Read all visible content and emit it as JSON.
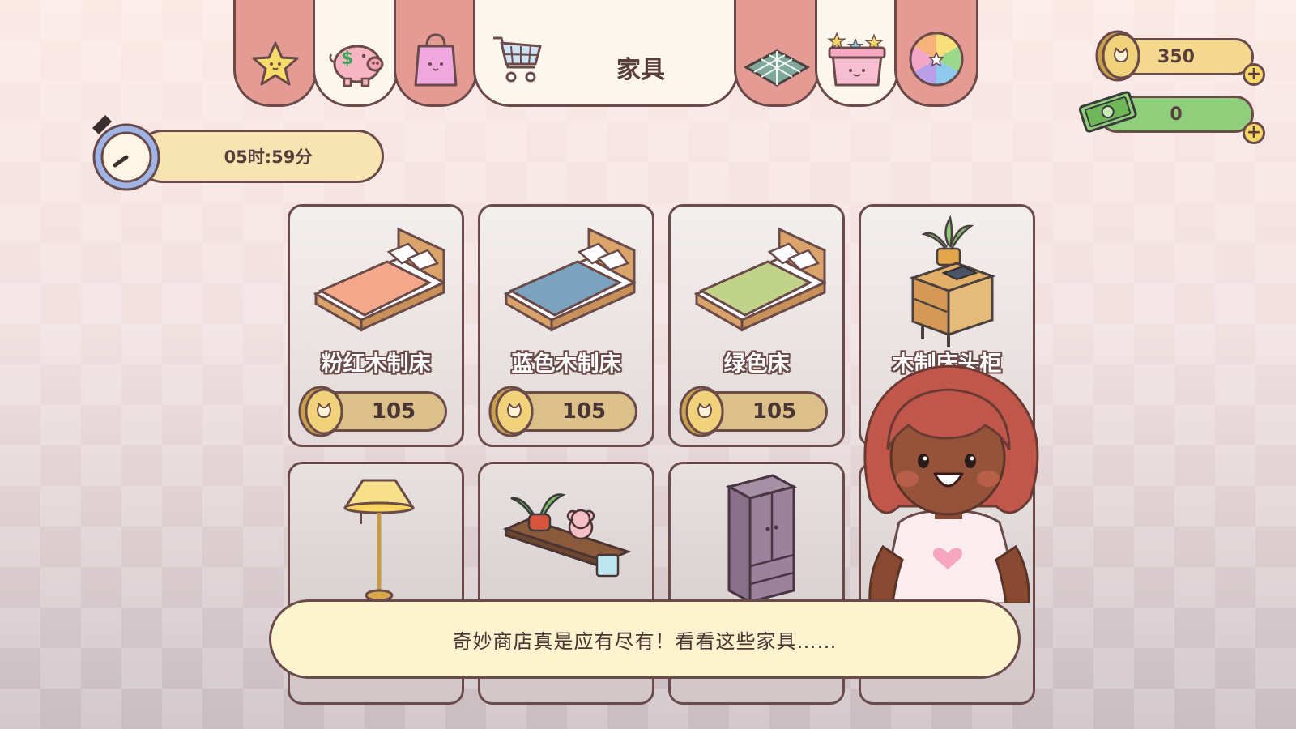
{
  "shop": {
    "tabs": [
      {
        "icon": "star-icon"
      },
      {
        "icon": "piggy-bank-icon"
      },
      {
        "icon": "shopping-bag-icon"
      },
      {
        "icon": "shopping-cart-icon",
        "label": "家具",
        "active": true
      },
      {
        "icon": "floor-tile-icon"
      },
      {
        "icon": "gift-box-icon"
      },
      {
        "icon": "prize-wheel-icon"
      }
    ]
  },
  "currency": {
    "coins": "350",
    "cash": "0"
  },
  "timer": {
    "text": "05时:59分"
  },
  "items": [
    {
      "name": "粉红木制床",
      "price": "105",
      "icon": "pink-bed-icon"
    },
    {
      "name": "蓝色木制床",
      "price": "105",
      "icon": "blue-bed-icon"
    },
    {
      "name": "绿色床",
      "price": "105",
      "icon": "green-bed-icon"
    },
    {
      "name": "木制床头柜",
      "icon": "nightstand-icon"
    },
    {
      "icon": "floor-lamp-icon"
    },
    {
      "icon": "wall-shelf-icon"
    },
    {
      "icon": "wardrobe-icon"
    }
  ],
  "dialog": {
    "text": "奇妙商店真是应有尽有！看看这些家具……"
  },
  "colors": {
    "outline": "#6b4a4a",
    "tab_rose": "#e39b93",
    "tab_cream": "#fdf6ee",
    "coin_gold": "#e8c86a",
    "cash_green": "#8fce7a",
    "dialog_bg": "#fdf3cf"
  }
}
